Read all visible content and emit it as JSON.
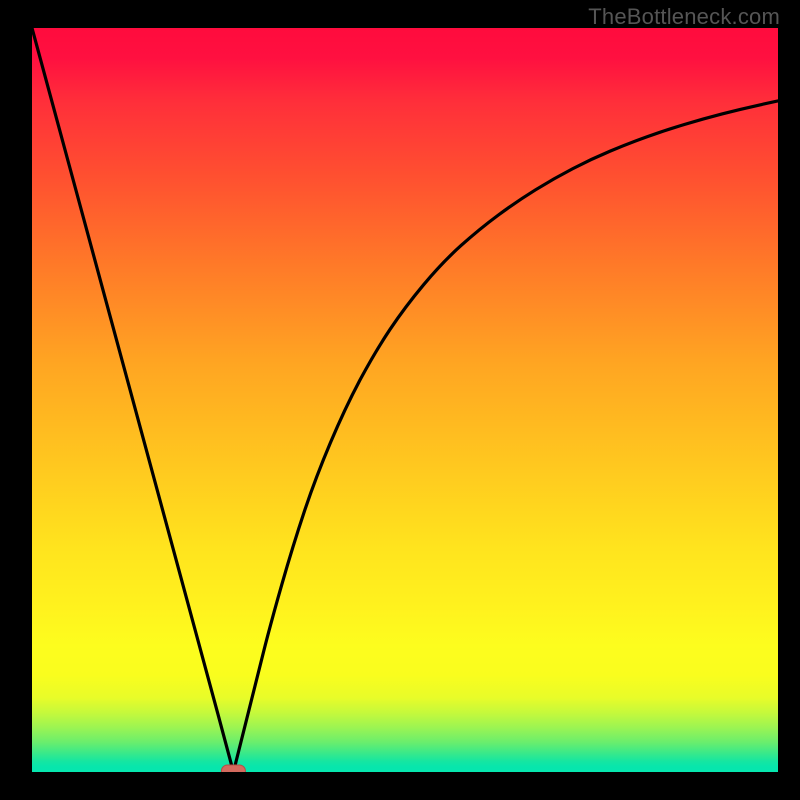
{
  "watermark": "TheBottleneck.com",
  "colors": {
    "frame": "#000000",
    "curve": "#000000",
    "marker_fill": "#d36a5e",
    "marker_stroke": "#b24f44"
  },
  "chart_data": {
    "type": "line",
    "title": "",
    "xlabel": "",
    "ylabel": "",
    "xlim": [
      0,
      100
    ],
    "ylim": [
      0,
      100
    ],
    "grid": false,
    "legend": false,
    "series": [
      {
        "name": "left-branch",
        "x": [
          0,
          5,
          10,
          15,
          20,
          25,
          27
        ],
        "y": [
          100,
          81.5,
          63,
          44.5,
          26,
          7.5,
          0
        ]
      },
      {
        "name": "right-branch",
        "x": [
          27,
          28,
          30,
          32,
          35,
          38,
          42,
          46,
          50,
          55,
          60,
          65,
          70,
          75,
          80,
          85,
          90,
          95,
          100
        ],
        "y": [
          0,
          4,
          12,
          20,
          30.5,
          39.5,
          49,
          56.5,
          62.5,
          68.5,
          73,
          76.7,
          79.8,
          82.4,
          84.5,
          86.3,
          87.8,
          89.1,
          90.2
        ]
      }
    ],
    "marker": {
      "x": 27,
      "y": 0,
      "shape": "rounded-rect"
    },
    "background_gradient": {
      "top": "#ff0b3d",
      "mid": "#ffe41e",
      "bottom": "#06e7af"
    }
  }
}
